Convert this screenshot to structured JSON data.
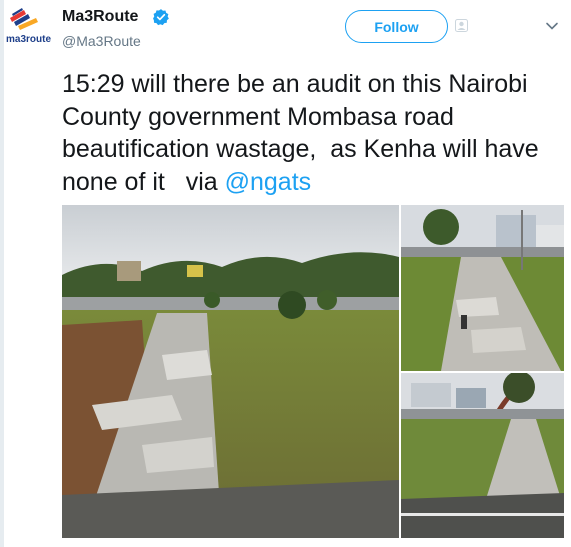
{
  "tweet": {
    "author_name": "Ma3Route",
    "author_handle": "@Ma3Route",
    "follow_label": "Follow",
    "text_main": "15:29 will there be an audit on this Nairobi County government Mombasa road beautification wastage,  as Kenha will have none of it   via ",
    "mention": "@ngats",
    "avatar_logo_text": "ma3route"
  },
  "icons": {
    "verified": "verified-badge-icon",
    "follow_person": "person-icon",
    "more": "chevron-down-icon"
  },
  "colors": {
    "accent": "#1da1f2",
    "text": "#14171a",
    "muted": "#657786"
  },
  "media": {
    "count": 3
  }
}
